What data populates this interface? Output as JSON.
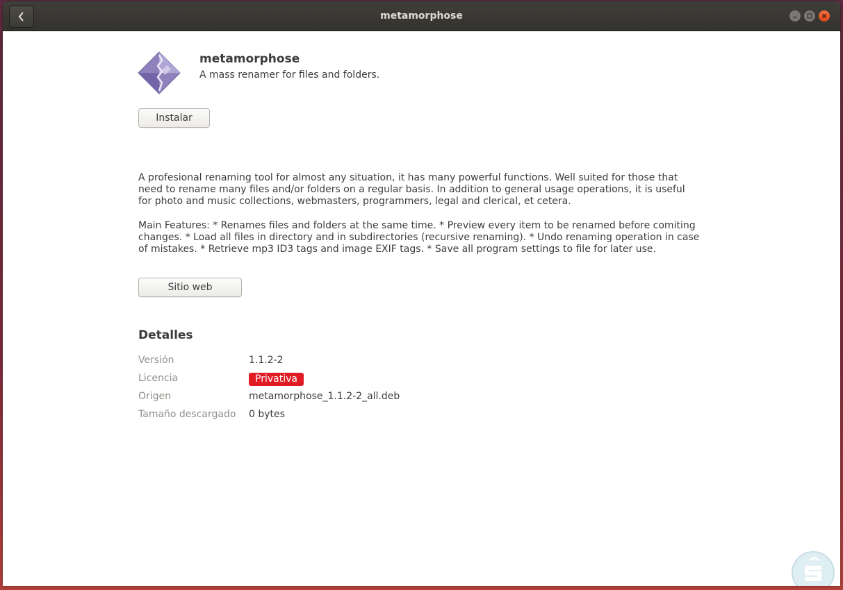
{
  "window": {
    "title": "metamorphose"
  },
  "app": {
    "name": "metamorphose",
    "summary": "A mass renamer for files and folders.",
    "install_label": "Instalar",
    "description": [
      "A profesional renaming tool for almost any situation, it has many powerful functions. Well suited for those that need to rename many files and/or folders on a regular basis. In addition to general usage operations, it is useful for photo and music collections, webmasters, programmers, legal and clerical, et cetera.",
      "Main Features: * Renames files and folders at the same time. * Preview every item to be renamed before comiting changes. * Load all files in directory and in subdirectories (recursive renaming). * Undo renaming operation in case of mistakes. * Retrieve mp3 ID3 tags and image EXIF tags. * Save all program settings to file for later use."
    ],
    "website_label": "Sitio web"
  },
  "details": {
    "heading": "Detalles",
    "rows": [
      {
        "label": "Versión",
        "value": "1.1.2-2"
      },
      {
        "label": "Licencia",
        "value": "Privativa"
      },
      {
        "label": "Origen",
        "value": "metamorphose_1.1.2-2_all.deb"
      },
      {
        "label": "Tamaño descargado",
        "value": "0 bytes"
      }
    ]
  },
  "colors": {
    "license_badge": "#e01b24",
    "titlebar": "#3c3b37",
    "close_button": "#e95420"
  },
  "icons": {
    "back": "chevron-left-icon",
    "minimize": "minimize-icon",
    "maximize": "maximize-icon",
    "close": "close-icon",
    "app": "metamorphose-app-icon",
    "watermark": "watermark-logo-icon"
  }
}
